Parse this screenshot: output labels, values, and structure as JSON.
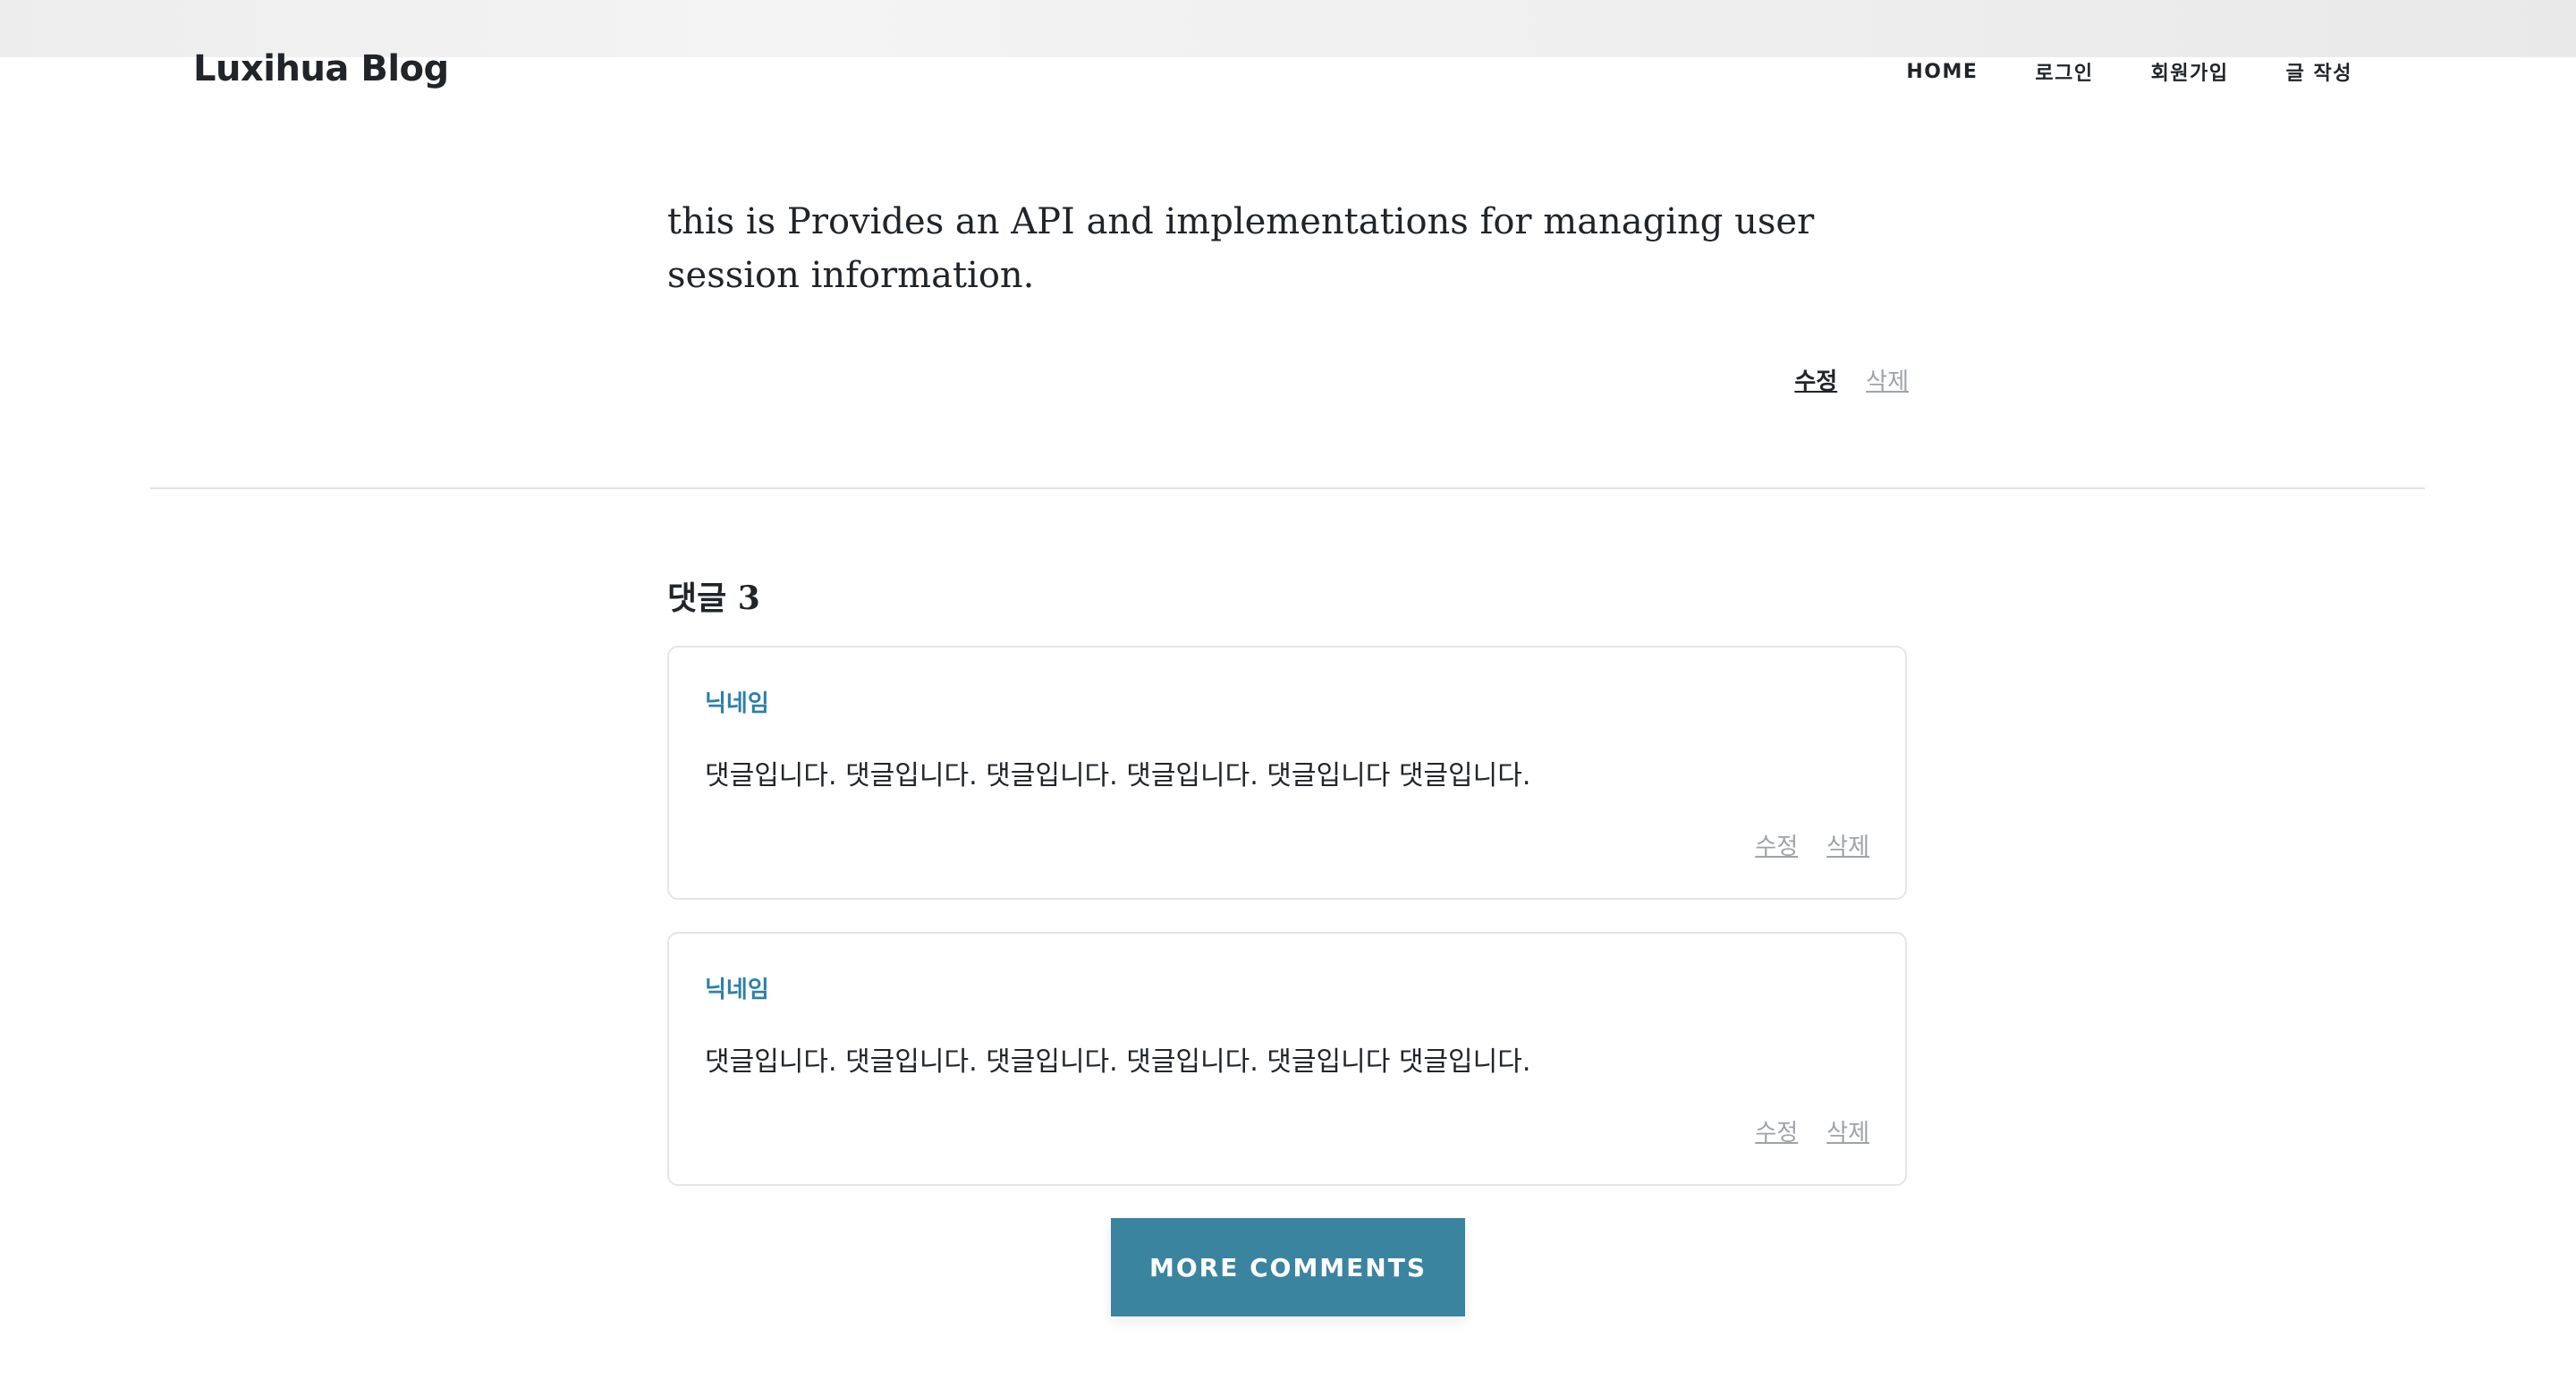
{
  "site": {
    "brand": "Luxihua Blog",
    "nav": [
      {
        "label": "HOME"
      },
      {
        "label": "로그인"
      },
      {
        "label": "회원가입"
      },
      {
        "label": "글 작성"
      }
    ]
  },
  "post": {
    "body": "this is Provides an API and implementations for managing user session information.",
    "edit_label": "수정",
    "delete_label": "삭제"
  },
  "comments": {
    "title": "댓글 3",
    "items": [
      {
        "nickname": "닉네임",
        "text": "댓글입니다. 댓글입니다. 댓글입니다. 댓글입니다. 댓글입니다 댓글입니다.",
        "edit_label": "수정",
        "delete_label": "삭제"
      },
      {
        "nickname": "닉네임",
        "text": "댓글입니다. 댓글입니다. 댓글입니다. 댓글입니다. 댓글입니다 댓글입니다.",
        "edit_label": "수정",
        "delete_label": "삭제"
      }
    ],
    "more_label": "MORE COMMENTS"
  },
  "colors": {
    "accent": "#3a849f",
    "nickname": "#2f80a6",
    "muted_link": "#9ea3a8"
  }
}
